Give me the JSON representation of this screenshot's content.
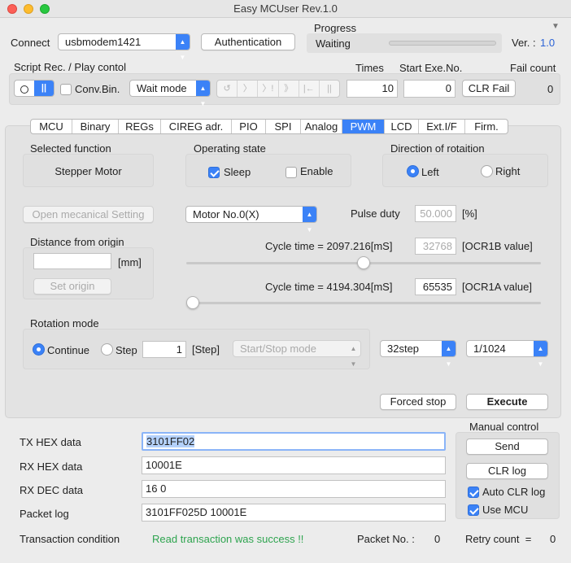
{
  "window": {
    "title": "Easy MCUser Rev.1.0"
  },
  "connect": {
    "label": "Connect",
    "port": "usbmodem1421",
    "auth_button": "Authentication"
  },
  "progress": {
    "label": "Progress",
    "status": "Waiting",
    "fraction": 0.0
  },
  "version": {
    "label": "Ver. :",
    "value": "1.0"
  },
  "script": {
    "label": "Script Rec. / Play contol",
    "conv_bin": "Conv.Bin.",
    "mode": "Wait mode",
    "times_label": "Times",
    "times_value": "10",
    "start_label": "Start Exe.No.",
    "start_value": "0",
    "clr_fail": "CLR Fail",
    "fail_label": "Fail count",
    "fail_value": "0"
  },
  "tabs": [
    "MCU",
    "Binary",
    "REGs",
    "CIREG adr.",
    "PIO",
    "SPI",
    "Analog",
    "PWM",
    "LCD",
    "Ext.I/F",
    "Firm."
  ],
  "active_tab": "PWM",
  "pwm": {
    "selected_function_label": "Selected function",
    "selected_function": "Stepper Motor",
    "operating_state_label": "Operating state",
    "sleep": "Sleep",
    "enable": "Enable",
    "direction_label": "Direction of rotaition",
    "left": "Left",
    "right": "Right",
    "open_setting": "Open mecanical Setting",
    "motor": "Motor No.0(X)",
    "pulse_duty_label": "Pulse duty",
    "pulse_duty_value": "50.000",
    "pulse_duty_unit": "[%]",
    "distance_label": "Distance from origin",
    "distance_unit": "[mm]",
    "set_origin": "Set origin",
    "cycle_b": "Cycle time = 2097.216[mS]",
    "ocr1b_value": "32768",
    "ocr1b_label": "[OCR1B value]",
    "slider_b_fraction": 0.5,
    "cycle_a": "Cycle time = 4194.304[mS]",
    "ocr1a_value": "65535",
    "ocr1a_label": "[OCR1A value]",
    "slider_a_fraction": 0.0,
    "rotation_label": "Rotation mode",
    "continue": "Continue",
    "step": "Step",
    "step_value": "1",
    "step_unit": "[Step]",
    "start_stop_mode": "Start/Stop mode",
    "step_res": "32step",
    "divider": "1/1024",
    "forced_stop": "Forced stop",
    "execute": "Execute"
  },
  "data": {
    "tx_label": "TX HEX data",
    "tx_value": "3101FF02",
    "rx_label": "RX HEX data",
    "rx_value": "10001E",
    "rxdec_label": "RX DEC data",
    "rxdec_value": "16 0",
    "packet_label": "Packet log",
    "packet_value": "3101FF025D 10001E"
  },
  "manual": {
    "label": "Manual control",
    "send": "Send",
    "clr_log": "CLR log",
    "auto_clr": "Auto CLR log",
    "use_mcu": "Use MCU"
  },
  "status": {
    "transaction_label": "Transaction condition",
    "transaction_value": "Read transaction was success !!",
    "packet_no_label": "Packet No. :",
    "packet_no": "0",
    "retry_label": "Retry count  =",
    "retry_value": "0"
  },
  "colors": {
    "accent": "#3b82f7",
    "success": "#2ea44f",
    "version": "#2a62d6"
  }
}
